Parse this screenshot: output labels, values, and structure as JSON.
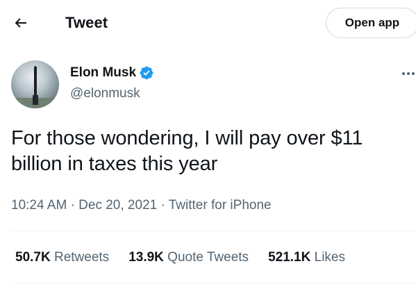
{
  "header": {
    "title": "Tweet",
    "open_app_label": "Open app"
  },
  "author": {
    "name": "Elon Musk",
    "handle": "@elonmusk",
    "verified": true
  },
  "tweet": {
    "text": "For those wondering, I will pay over $11 billion in taxes this year",
    "time": "10:24 AM",
    "date": "Dec 20, 2021",
    "source": "Twitter for iPhone",
    "separator": "·"
  },
  "stats": {
    "retweets": {
      "count": "50.7K",
      "label": "Retweets"
    },
    "quote_tweets": {
      "count": "13.9K",
      "label": "Quote Tweets"
    },
    "likes": {
      "count": "521.1K",
      "label": "Likes"
    }
  },
  "colors": {
    "text": "#0f1419",
    "secondary": "#536471",
    "verified": "#1d9bf0",
    "divider": "#eff3f4",
    "border": "#cfd9de"
  }
}
